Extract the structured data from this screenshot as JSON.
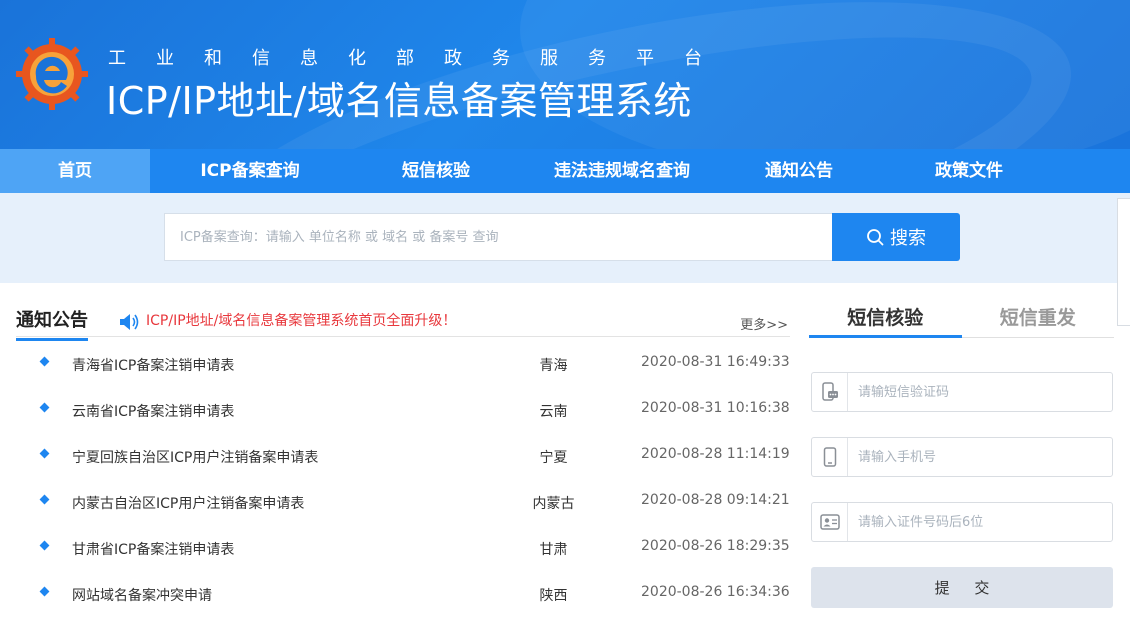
{
  "header": {
    "subtitle": "工业和信息化部政务服务平台",
    "title": "ICP/IP地址/域名信息备案管理系统"
  },
  "nav": {
    "items": [
      {
        "label": "首页",
        "active": true
      },
      {
        "label": "ICP备案查询"
      },
      {
        "label": "短信核验"
      },
      {
        "label": "违法违规域名查询"
      },
      {
        "label": "通知公告"
      },
      {
        "label": "政策文件"
      }
    ]
  },
  "search": {
    "placeholder": "ICP备案查询：请输入 单位名称 或 域名 或 备案号 查询",
    "button_label": "搜索"
  },
  "notice": {
    "title": "通知公告",
    "marquee": "ICP/IP地址/域名信息备案管理系统首页全面升级！",
    "more": "更多>>",
    "rows": [
      {
        "title": "青海省ICP备案注销申请表",
        "region": "青海",
        "time": "2020-08-31 16:49:33"
      },
      {
        "title": "云南省ICP备案注销申请表",
        "region": "云南",
        "time": "2020-08-31 10:16:38"
      },
      {
        "title": "宁夏回族自治区ICP用户注销备案申请表",
        "region": "宁夏",
        "time": "2020-08-28 11:14:19"
      },
      {
        "title": "内蒙古自治区ICP用户注销备案申请表",
        "region": "内蒙古",
        "time": "2020-08-28 09:14:21"
      },
      {
        "title": "甘肃省ICP备案注销申请表",
        "region": "甘肃",
        "time": "2020-08-26 18:29:35"
      },
      {
        "title": "网站域名备案冲突申请",
        "region": "陕西",
        "time": "2020-08-26 16:34:36"
      }
    ]
  },
  "sms": {
    "tabs": [
      {
        "label": "短信核验",
        "active": true
      },
      {
        "label": "短信重发"
      }
    ],
    "code_placeholder": "请输短信验证码",
    "phone_placeholder": "请输入手机号",
    "id_placeholder": "请输入证件号码后6位",
    "submit_label": "提 交"
  },
  "colors": {
    "brand_blue": "#1e86f0",
    "nav_active": "#4ea4f5",
    "alert_red": "#e8383d"
  }
}
